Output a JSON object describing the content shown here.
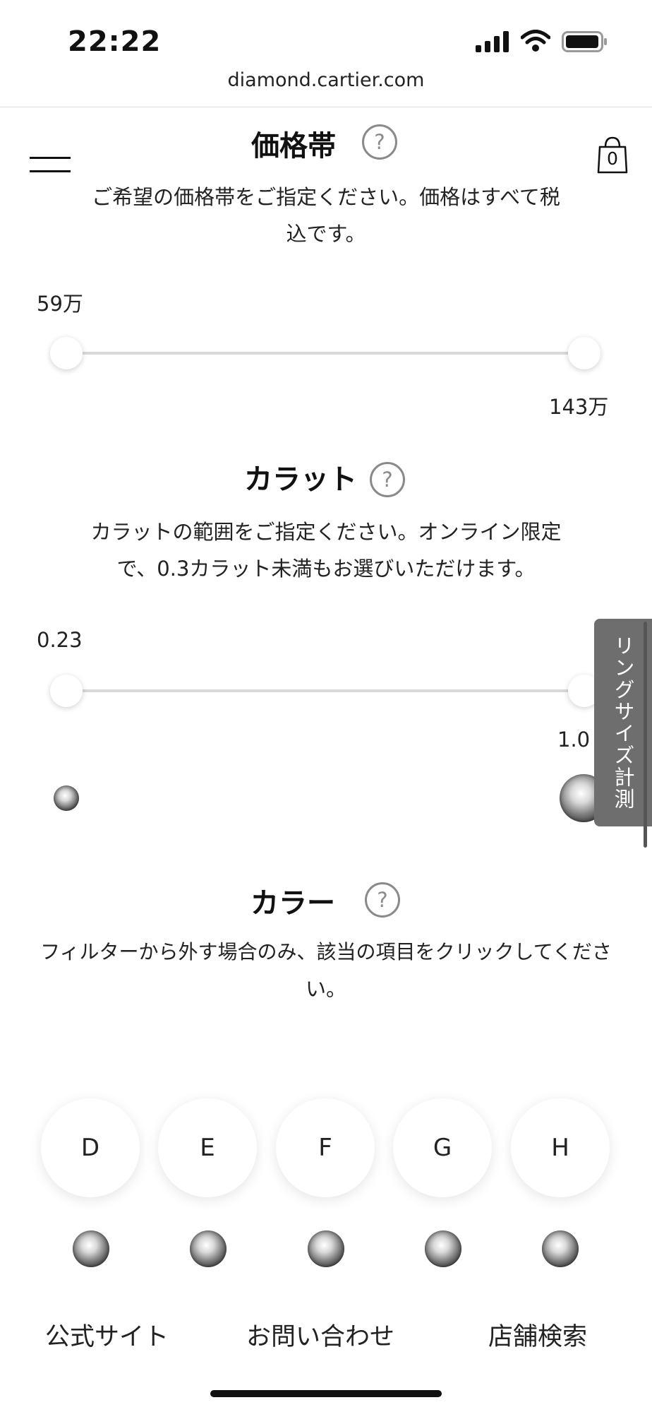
{
  "status_bar": {
    "time": "22:22"
  },
  "browser": {
    "url": "diamond.cartier.com"
  },
  "header": {
    "cart_count": "0"
  },
  "price_section": {
    "title": "価格帯",
    "help": "?",
    "description_line1": "ご希望の価格帯をご指定ください。価格はすべて税",
    "description_line2": "込です。",
    "min_label": "59万",
    "max_label": "143万"
  },
  "carat_section": {
    "title": "カラット",
    "help": "?",
    "description_line1": "カラットの範囲をご指定ください。オンライン限定",
    "description_line2": "で、0.3カラット未満もお選びいただけます。",
    "min_label": "0.23",
    "max_label": "1.0"
  },
  "ring_size_tab": {
    "label": "リングサイズ計測"
  },
  "color_section": {
    "title": "カラー",
    "help": "?",
    "description_line1": "フィルターから外す場合のみ、該当の項目をクリックしてくださ",
    "description_line2": "い。",
    "grades": [
      "D",
      "E",
      "F",
      "G",
      "H"
    ]
  },
  "footer": {
    "official_site": "公式サイト",
    "contact": "お問い合わせ",
    "store_search": "店舗検索"
  }
}
